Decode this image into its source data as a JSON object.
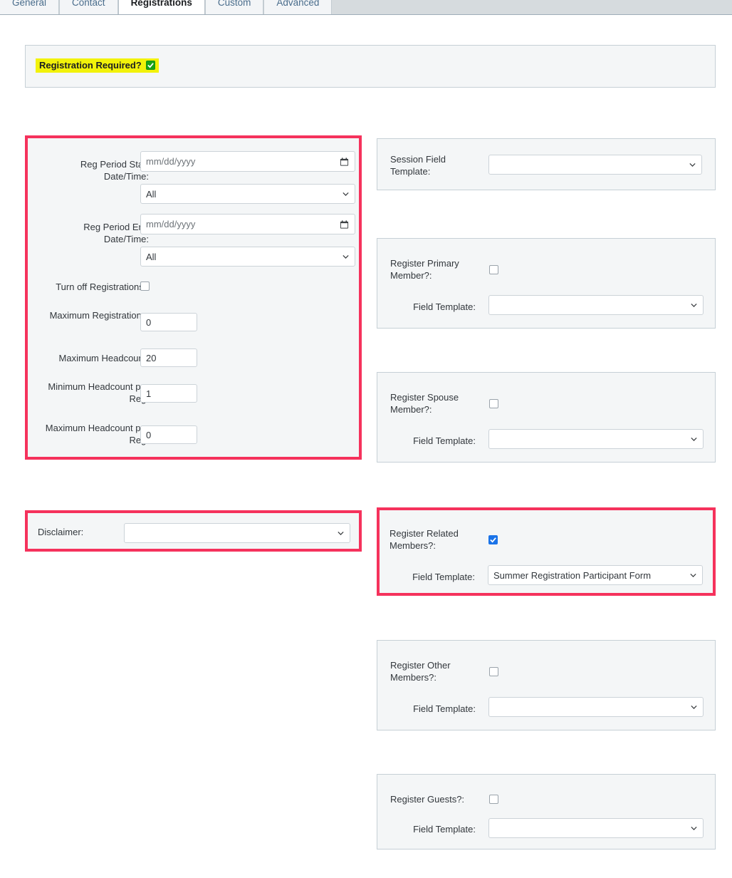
{
  "tabs": [
    {
      "label": "General",
      "active": false
    },
    {
      "label": "Contact",
      "active": false
    },
    {
      "label": "Registrations",
      "active": true
    },
    {
      "label": "Custom",
      "active": false
    },
    {
      "label": "Advanced",
      "active": false
    }
  ],
  "registration_required": {
    "label": "Registration Required?",
    "checked": true,
    "highlight_color": "#f2f20a",
    "check_color": "#19a319"
  },
  "left_panel": {
    "highlight_color": "#f5325c",
    "reg_start": {
      "label": "Reg Period Start Date/Time:",
      "date_placeholder": "mm/dd/yyyy",
      "date_value": "",
      "time_value": "All"
    },
    "reg_end": {
      "label": "Reg Period End Date/Time:",
      "date_placeholder": "mm/dd/yyyy",
      "date_value": "",
      "time_value": "All"
    },
    "turn_off": {
      "label": "Turn off Registrations?",
      "checked": false
    },
    "max_registrations": {
      "label": "Maximum Registrations:",
      "value": "0"
    },
    "max_headcount": {
      "label": "Maximum Headcount:",
      "value": "20"
    },
    "min_headcount_per_reg": {
      "label": "Minimum Headcount per Reg:",
      "value": "1"
    },
    "max_headcount_per_reg": {
      "label": "Maximum Headcount per Reg:",
      "value": "0"
    }
  },
  "disclaimer": {
    "label": "Disclaimer:",
    "value": "",
    "highlight_color": "#f5325c"
  },
  "session_field_template": {
    "label": "Session Field Template:",
    "value": ""
  },
  "register_primary": {
    "label": "Register Primary Member?:",
    "checked": false,
    "template_label": "Field Template:",
    "template_value": ""
  },
  "register_spouse": {
    "label": "Register Spouse Member?:",
    "checked": false,
    "template_label": "Field Template:",
    "template_value": ""
  },
  "register_related": {
    "label": "Register Related Members?:",
    "checked": true,
    "template_label": "Field Template:",
    "template_value": "Summer Registration Participant Form",
    "highlight_color": "#f5325c"
  },
  "register_other": {
    "label": "Register Other Members?:",
    "checked": false,
    "template_label": "Field Template:",
    "template_value": ""
  },
  "register_guests": {
    "label": "Register Guests?:",
    "checked": false,
    "template_label": "Field Template:",
    "template_value": ""
  }
}
